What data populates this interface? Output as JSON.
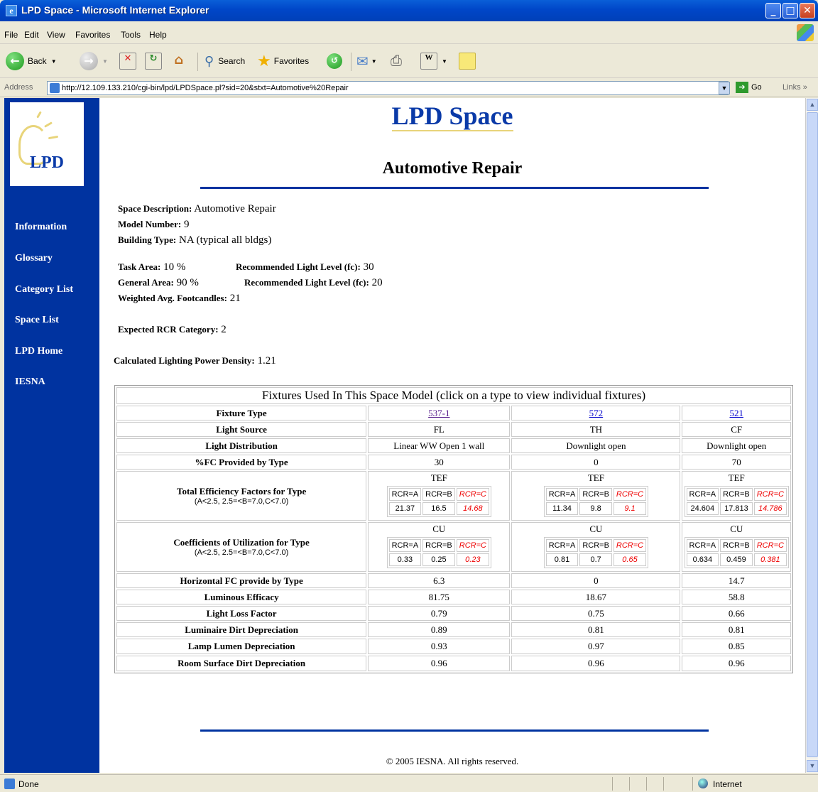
{
  "window": {
    "title": "LPD Space - Microsoft Internet Explorer"
  },
  "menu": [
    "File",
    "Edit",
    "View",
    "Favorites",
    "Tools",
    "Help"
  ],
  "toolbar": {
    "back": "Back",
    "search": "Search",
    "favorites": "Favorites"
  },
  "address": {
    "label": "Address",
    "url": "http://12.109.133.210/cgi-bin/lpd/LPDSpace.pl?sid=20&stxt=Automotive%20Repair",
    "go": "Go",
    "links": "Links"
  },
  "logo": {
    "text": "LPD"
  },
  "sidebar": {
    "items": [
      {
        "label": "Information"
      },
      {
        "label": "Glossary"
      },
      {
        "label": "Category List"
      },
      {
        "label": "Space List"
      },
      {
        "label": "LPD Home"
      },
      {
        "label": "IESNA"
      }
    ]
  },
  "page": {
    "title": "LPD Space",
    "space_name": "Automotive Repair",
    "copyright": "© 2005 IESNA. All rights reserved."
  },
  "info": {
    "space_description_label": "Space Description:",
    "space_description": "Automotive Repair",
    "model_number_label": "Model Number:",
    "model_number": "9",
    "building_type_label": "Building Type:",
    "building_type": "NA (typical all bldgs)",
    "task_area_label": "Task Area:",
    "task_area": "10 %",
    "task_rll_label": "Recommended Light Level (fc):",
    "task_rll": "30",
    "general_area_label": "General Area:",
    "general_area": "90 %",
    "general_rll_label": "Recommended Light Level (fc):",
    "general_rll": "20",
    "weighted_label": "Weighted Avg. Footcandles:",
    "weighted": "21",
    "rcr_label": "Expected RCR Category:",
    "rcr": "2",
    "lpd_label": "Calculated Lighting Power Density:",
    "lpd": "1.21"
  },
  "table": {
    "caption": "Fixtures Used In This Space Model (click on a type to view individual fixtures)",
    "row_labels": {
      "fixture_type": "Fixture Type",
      "light_source": "Light Source",
      "light_distribution": "Light Distribution",
      "pct_fc": "%FC Provided by Type",
      "tef": "Total Efficiency Factors for Type",
      "tef_sub": "(A<2.5, 2.5=<B=7.0,C<7.0)",
      "cu": "Coefficients of Utilization for Type",
      "cu_sub": "(A<2.5, 2.5=<B=7.0,C<7.0)",
      "hfc": "Horizontal FC provide by Type",
      "efficacy": "Luminous Efficacy",
      "llf": "Light Loss Factor",
      "ldd": "Luminaire Dirt Depreciation",
      "lld": "Lamp Lumen Depreciation",
      "rsdd": "Room Surface Dirt Depreciation"
    },
    "tef_label": "TEF",
    "cu_label": "CU",
    "rcr_headers": [
      "RCR=A",
      "RCR=B",
      "RCR=C"
    ],
    "fixtures": [
      {
        "type": "537-1",
        "source": "FL",
        "distribution": "Linear WW Open 1 wall",
        "pct_fc": "30",
        "tef": [
          "21.37",
          "16.5",
          "14.68"
        ],
        "cu": [
          "0.33",
          "0.25",
          "0.23"
        ],
        "hfc": "6.3",
        "efficacy": "81.75",
        "llf": "0.79",
        "ldd": "0.89",
        "lld": "0.93",
        "rsdd": "0.96"
      },
      {
        "type": "572",
        "source": "TH",
        "distribution": "Downlight open",
        "pct_fc": "0",
        "tef": [
          "11.34",
          "9.8",
          "9.1"
        ],
        "cu": [
          "0.81",
          "0.7",
          "0.65"
        ],
        "hfc": "0",
        "efficacy": "18.67",
        "llf": "0.75",
        "ldd": "0.81",
        "lld": "0.97",
        "rsdd": "0.96"
      },
      {
        "type": "521",
        "source": "CF",
        "distribution": "Downlight open",
        "pct_fc": "70",
        "tef": [
          "24.604",
          "17.813",
          "14.786"
        ],
        "cu": [
          "0.634",
          "0.459",
          "0.381"
        ],
        "hfc": "14.7",
        "efficacy": "58.8",
        "llf": "0.66",
        "ldd": "0.81",
        "lld": "0.85",
        "rsdd": "0.96"
      }
    ]
  },
  "status": {
    "text": "Done",
    "zone": "Internet"
  }
}
